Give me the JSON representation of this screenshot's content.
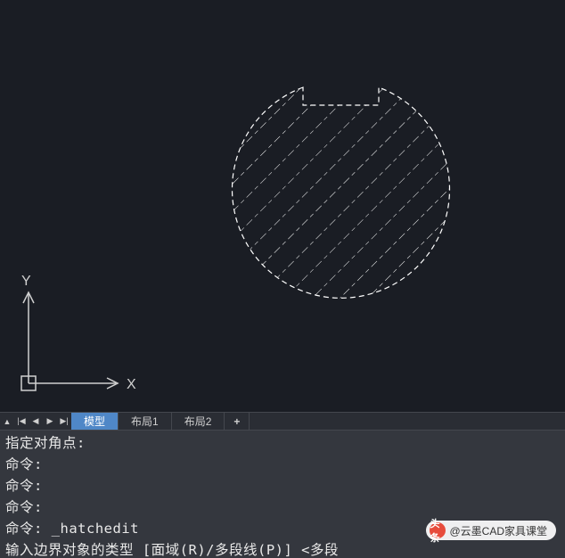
{
  "canvas": {
    "ucs": {
      "x_label": "X",
      "y_label": "Y"
    }
  },
  "tabs": {
    "nav": {
      "collapse": "▲",
      "first": "|◀",
      "prev": "◀",
      "next": "▶",
      "last": "▶|"
    },
    "items": [
      {
        "label": "模型",
        "active": true
      },
      {
        "label": "布局1",
        "active": false
      },
      {
        "label": "布局2",
        "active": false
      }
    ],
    "add": "+"
  },
  "command": {
    "lines": [
      "指定对角点:",
      "命令:",
      "命令:",
      "命令:",
      "命令: _hatchedit",
      "输入边界对象的类型 [面域(R)/多段线(P)] <多段"
    ]
  },
  "watermark": {
    "prefix": "头条",
    "text": "@云墨CAD家具课堂"
  }
}
